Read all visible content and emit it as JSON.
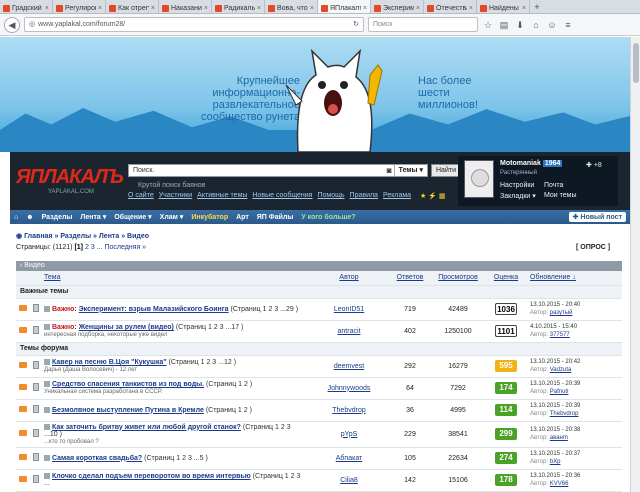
{
  "browser": {
    "tabs": [
      {
        "label": "Градский"
      },
      {
        "label": "Регулиров..."
      },
      {
        "label": "Как отрегу..."
      },
      {
        "label": "Наказание..."
      },
      {
        "label": "Радикальн..."
      },
      {
        "label": "Вова, что..."
      },
      {
        "label": "ЯПлакалъ",
        "active": true
      },
      {
        "label": "Эксперимен..."
      },
      {
        "label": "Отечества..."
      },
      {
        "label": "Найдены ..."
      }
    ],
    "new_tab": "+",
    "url": "www.yaplakal.com/forum28/",
    "search_placeholder": "Поиск"
  },
  "banner": {
    "slogan_left": "Крупнейшее информационно-развлекательное сообщество рунета",
    "slogan_right": "Нас более шести миллионов!"
  },
  "header": {
    "logo": "ЯПЛАКАЛЪ",
    "logo_sub": "YAPLAKAL.COM",
    "search_value": "Поиск.",
    "search_scope": "Темы",
    "search_button": "Найти",
    "search_hint": "Крутой поиск баянов",
    "links": [
      "О сайте",
      "Участники",
      "Активные темы",
      "Новые сообщения",
      "Помощь",
      "Правила",
      "Реклама"
    ],
    "user": {
      "name": "Motomaniak",
      "count": "1964",
      "plus": "+8",
      "rank": "Растерянный",
      "links": [
        "Настройки",
        "Почта",
        "Закладки ▾",
        "Мои темы"
      ]
    }
  },
  "menu": {
    "items": [
      "Разделы",
      "Лента ▾",
      "Общение ▾",
      "Хлам ▾",
      "Инкубатор",
      "Арт",
      "ЯП Файлы",
      "У кого больше?"
    ],
    "new_post": "Новый пост"
  },
  "breadcrumb": "Главная » Разделы » Лента » Видео",
  "pagination": {
    "label": "Страницы:",
    "total": "(1121)",
    "current": "[1]",
    "p2": "2",
    "p3": "3",
    "ellipsis": "...",
    "last": "Последняя »"
  },
  "poll_button": "[ ОПРОС ]",
  "section_title": "‹ Видео",
  "table": {
    "headers": {
      "topic": "Тема",
      "author": "Автор",
      "replies": "Ответов",
      "views": "Просмотров",
      "rating": "Оценка",
      "updated": "Обновление ↓"
    },
    "group_important": "Важные темы",
    "group_forum": "Темы форума",
    "important": [
      {
        "prefix": "Важно:",
        "title": "Эксперимент: взрыв Малазийского Боинга",
        "pages": "(Страниц 1 2 3 ...29 )",
        "desc": "",
        "author": "LeonID51",
        "replies": "719",
        "views": "42489",
        "rating": "1036",
        "updated": "13.10.2015 - 20:40",
        "last_author": "разутый"
      },
      {
        "prefix": "Важно:",
        "title": "Женщины за рулем (видео)",
        "pages": "(Страниц 1 2 3 ...17 )",
        "desc": "интересная подборка, некоторые уже видел",
        "author": "antracit",
        "replies": "402",
        "views": "1250100",
        "rating": "1101",
        "updated": "4.10.2015 - 15:40",
        "last_author": "377577"
      }
    ],
    "topics": [
      {
        "title": "Кавер на песню В.Цоя \"Кукушка\"",
        "pages": "(Страниц 1 2 3 ...12 )",
        "desc": "Дарья (Даша Волосевич) - 12 лет",
        "author": "deemvest",
        "replies": "292",
        "views": "16279",
        "rating": "595",
        "rating_color": "y",
        "updated": "13.10.2015 - 20:42",
        "last_author": "Vadzuta"
      },
      {
        "title": "Средство спасения танкистов из под воды.",
        "pages": "(Страниц 1 2 )",
        "desc": "Уникальная система разработана в СССР.",
        "author": "Johnnywoods",
        "replies": "64",
        "views": "7292",
        "rating": "174",
        "rating_color": "g",
        "updated": "13.10.2015 - 20:39",
        "last_author": "Pafnuti"
      },
      {
        "title": "Безмолвное выступление Путина в Кремле",
        "pages": "(Страниц 1 2 )",
        "desc": "",
        "author": "Thebvdrop",
        "replies": "36",
        "views": "4995",
        "rating": "114",
        "rating_color": "g",
        "updated": "13.10.2015 - 20:39",
        "last_author": "Thebvdrop"
      },
      {
        "title": "Как заточить бритву живет или любой другой станок?",
        "pages": "(Страниц 1 2 3 ...10 )",
        "desc": "...кто то пробовал ?",
        "author": "pYpS",
        "replies": "229",
        "views": "38541",
        "rating": "299",
        "rating_color": "g",
        "updated": "13.10.2015 - 20:38",
        "last_author": "aванm"
      },
      {
        "title": "Самая короткая свадьба?",
        "pages": "(Страниц 1 2 3 ...5 )",
        "desc": "",
        "author": "Абпакат",
        "replies": "105",
        "views": "22634",
        "rating": "274",
        "rating_color": "g",
        "updated": "13.10.2015 - 20:37",
        "last_author": "bXp"
      },
      {
        "title": "Клочко сделал подъем переворотом во время интервью",
        "pages": "(Страниц 1 2 3 ...",
        "desc": "",
        "author": "Cilia8",
        "replies": "142",
        "views": "15106",
        "rating": "178",
        "rating_color": "g",
        "updated": "13.10.2015 - 20:36",
        "last_author": "KVV66"
      }
    ]
  }
}
